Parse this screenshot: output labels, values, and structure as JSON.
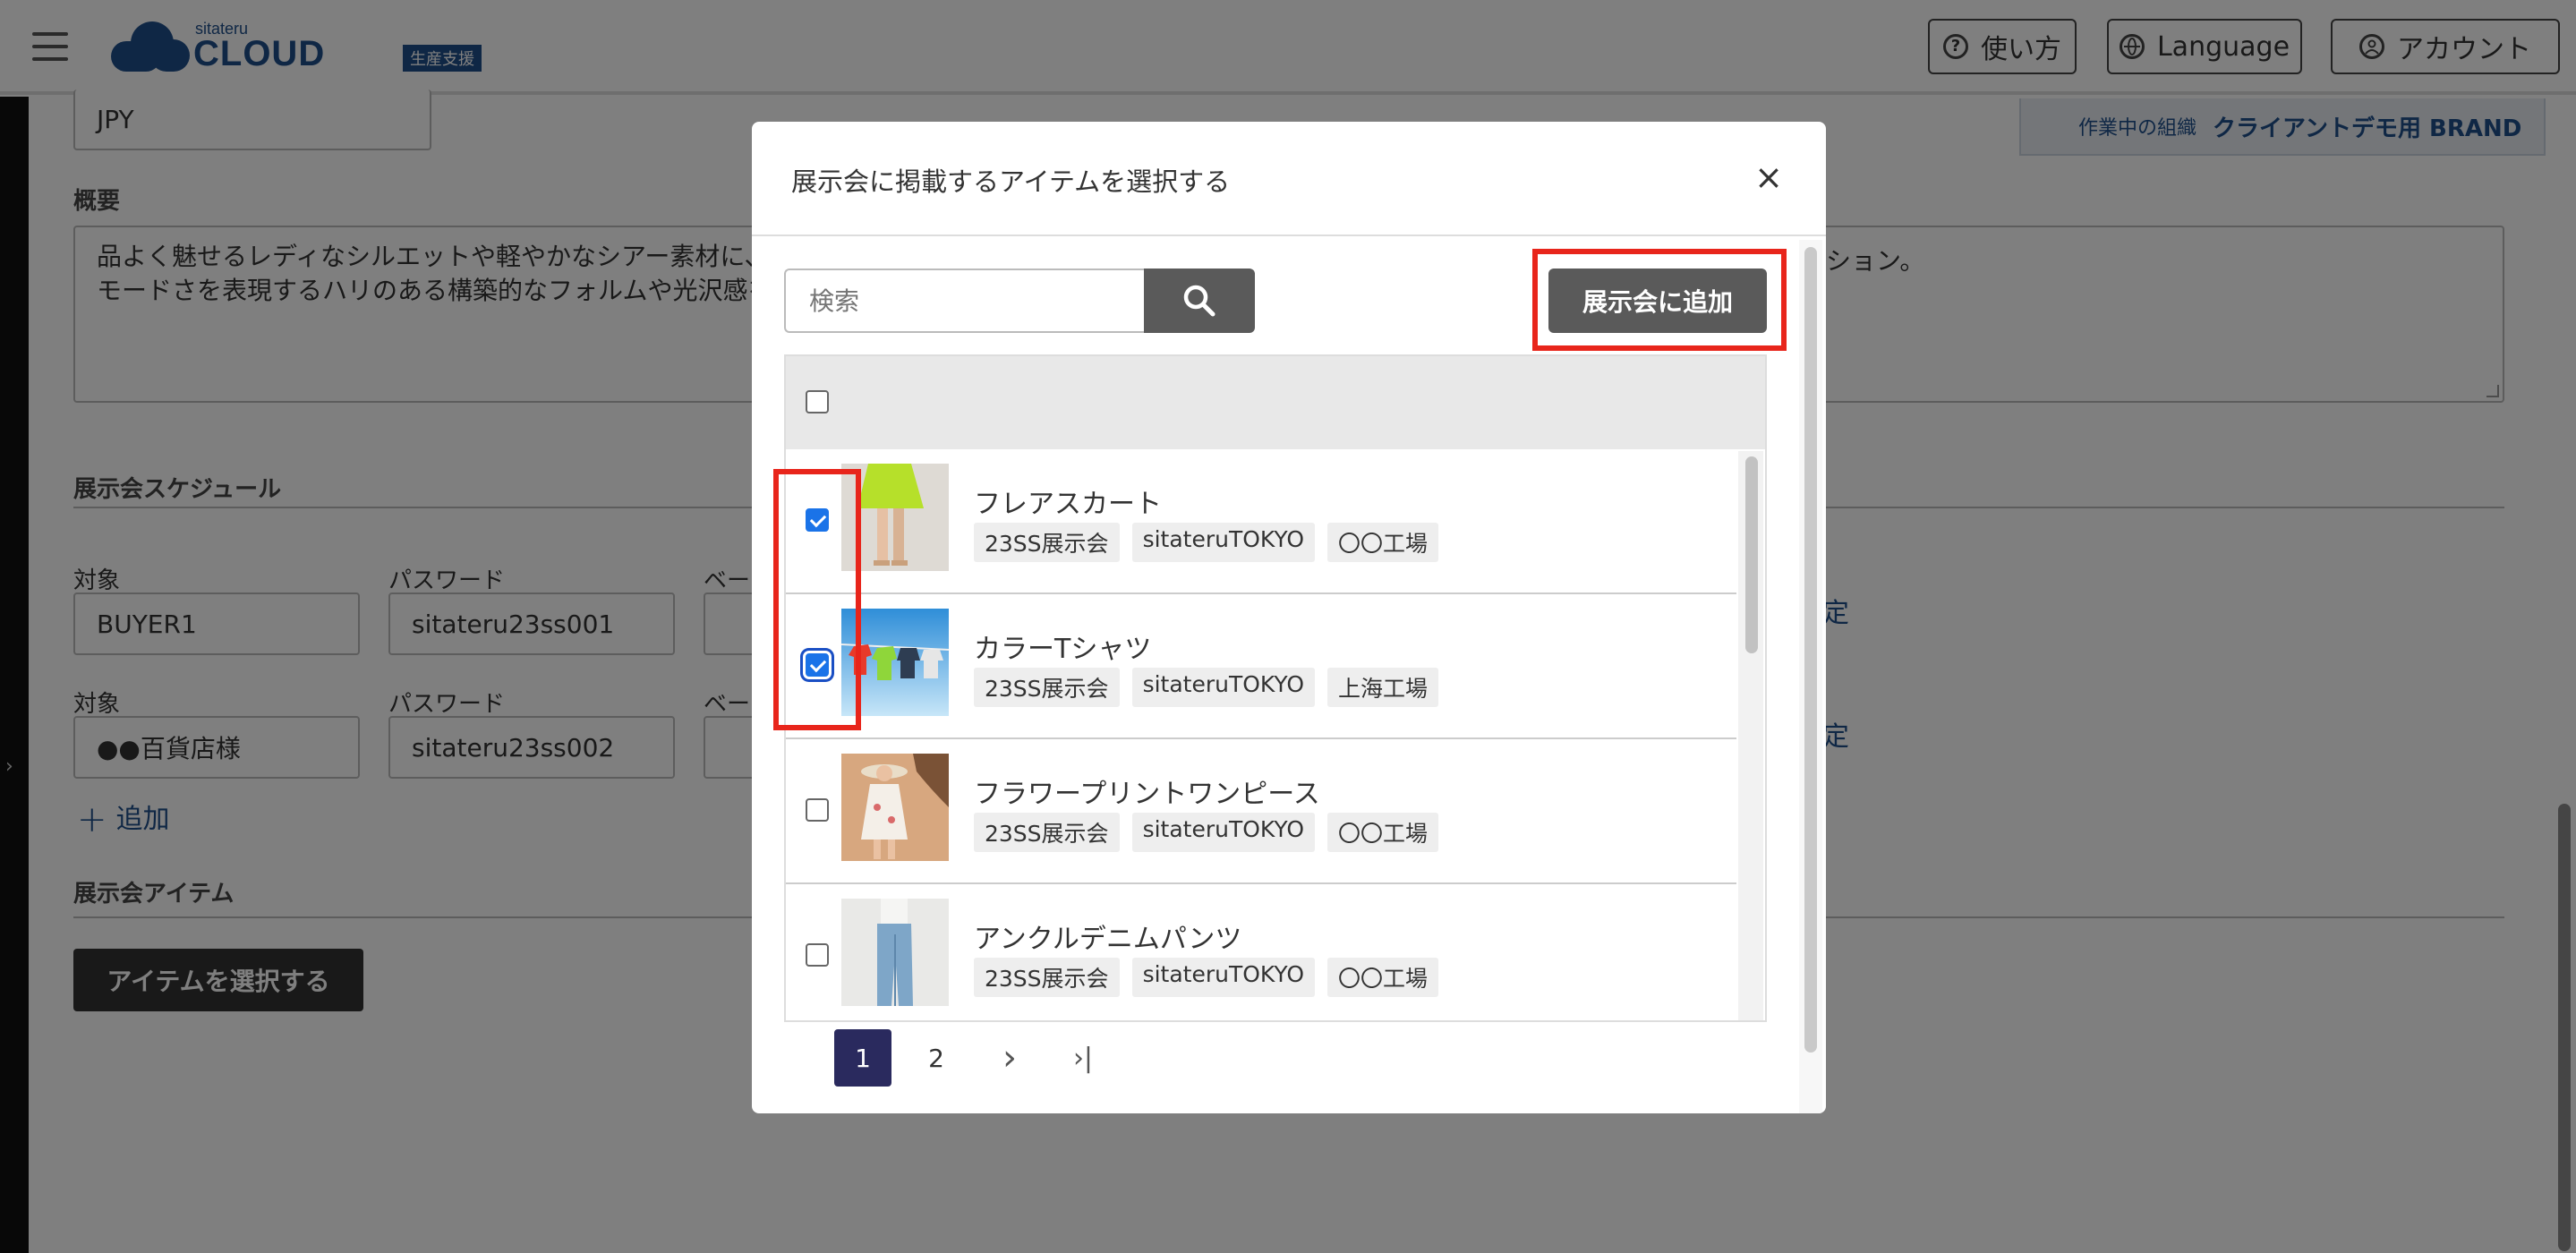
{
  "header": {
    "logo_small": "sitateru",
    "logo_big": "CLOUD",
    "logo_badge": "生産支援",
    "help_label": "使い方",
    "language_label": "Language",
    "account_label": "アカウント"
  },
  "org": {
    "label": "作業中の組織",
    "name": "クライアントデモ用 BRAND"
  },
  "page": {
    "currency_value": "JPY",
    "summary_label": "概要",
    "summary_line1": "品よく魅せるレディなシルエットや軽やかなシアー素材に、",
    "summary_line2": "モードさを表現するハリのある構築的なフォルムや光沢感を",
    "summary_right_fragment": "ション。",
    "schedule_label": "展示会スケジュール",
    "schedule_rows": [
      {
        "target_label": "対象",
        "target_value": "BUYER1",
        "password_label": "パスワード",
        "password_value": "sitateru23ss001",
        "extra_label": "ベー",
        "right_link": "定"
      },
      {
        "target_label": "対象",
        "target_value": "●●百貨店様",
        "password_label": "パスワード",
        "password_value": "sitateru23ss002",
        "extra_label": "ベー",
        "right_link": "定"
      }
    ],
    "add_label": "追加",
    "items_label": "展示会アイテム",
    "select_items_button": "アイテムを選択する"
  },
  "modal": {
    "title": "展示会に掲載するアイテムを選択する",
    "close_symbol": "×",
    "search_placeholder": "検索",
    "add_button": "展示会に追加",
    "items": [
      {
        "name": "フレアスカート",
        "tags": [
          "23SS展示会",
          "sitateruTOKYO",
          "〇〇工場"
        ],
        "checked": true
      },
      {
        "name": "カラーTシャツ",
        "tags": [
          "23SS展示会",
          "sitateruTOKYO",
          "上海工場"
        ],
        "checked": true
      },
      {
        "name": "フラワープリントワンピース",
        "tags": [
          "23SS展示会",
          "sitateruTOKYO",
          "〇〇工場"
        ],
        "checked": false
      },
      {
        "name": "アンクルデニムパンツ",
        "tags": [
          "23SS展示会",
          "sitateruTOKYO",
          "〇〇工場"
        ],
        "checked": false
      }
    ],
    "pagination": {
      "pages": [
        "1",
        "2"
      ],
      "current": "1",
      "next_symbol": "›",
      "last_symbol": "›|"
    }
  },
  "colors": {
    "brand": "#1f4f8b",
    "highlight": "#e8251b",
    "checkbox": "#1a73e8",
    "active_page": "#2a2a5e"
  },
  "icons": [
    "menu-icon",
    "help-icon",
    "globe-icon",
    "account-icon",
    "search-icon",
    "close-icon",
    "plus-icon",
    "chevron-right-icon",
    "last-page-icon"
  ]
}
